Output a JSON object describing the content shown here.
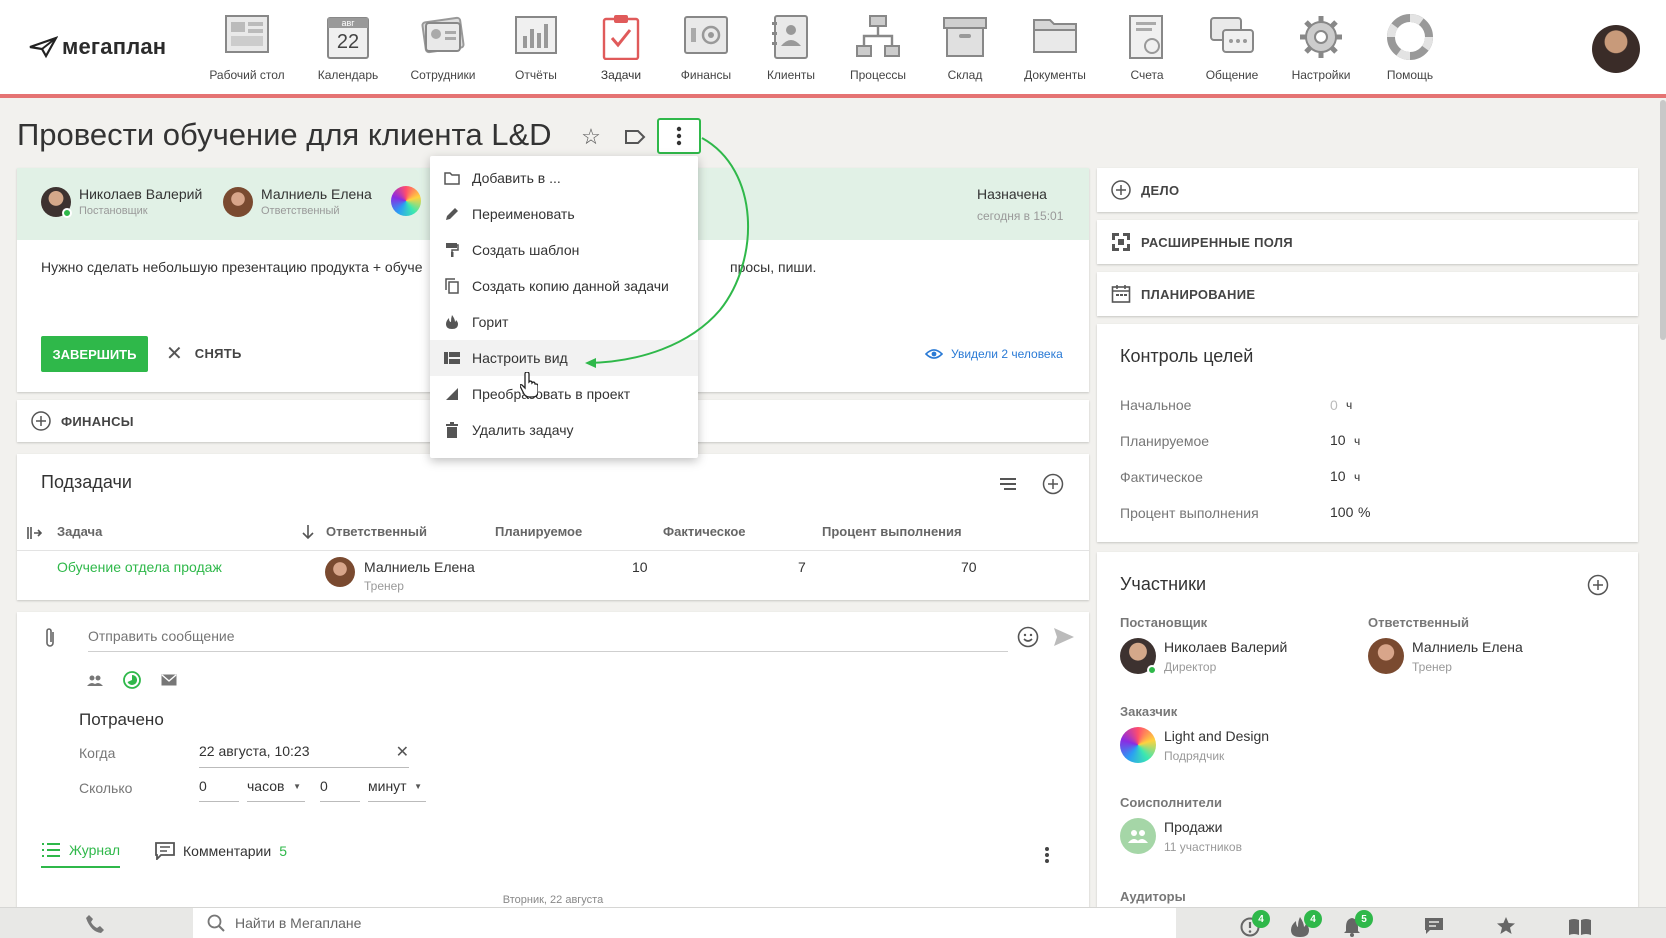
{
  "logo": {
    "text": "мегаплан"
  },
  "nav": [
    {
      "label": "Рабочий стол",
      "icon": "desktop-icon"
    },
    {
      "label": "Календарь",
      "icon": "calendar-icon",
      "month": "авг",
      "day": "22"
    },
    {
      "label": "Сотрудники",
      "icon": "employees-icon"
    },
    {
      "label": "Отчёты",
      "icon": "reports-icon"
    },
    {
      "label": "Задачи",
      "icon": "tasks-icon"
    },
    {
      "label": "Финансы",
      "icon": "finance-icon"
    },
    {
      "label": "Клиенты",
      "icon": "clients-icon"
    },
    {
      "label": "Процессы",
      "icon": "processes-icon"
    },
    {
      "label": "Склад",
      "icon": "warehouse-icon"
    },
    {
      "label": "Документы",
      "icon": "documents-icon"
    },
    {
      "label": "Счета",
      "icon": "invoices-icon"
    },
    {
      "label": "Общение",
      "icon": "chat-icon"
    },
    {
      "label": "Настройки",
      "icon": "settings-icon"
    },
    {
      "label": "Помощь",
      "icon": "help-icon"
    }
  ],
  "task": {
    "title": "Провести обучение для клиента L&D",
    "owner": {
      "name": "Николаев Валерий",
      "role": "Постановщик"
    },
    "responsible": {
      "name": "Малниель Елена",
      "role": "Ответственный"
    },
    "status": {
      "label": "Назначена",
      "time": "сегодня в 15:01"
    },
    "description_left": "Нужно сделать небольшую презентацию продукта + обуче",
    "description_right": "просы, пиши.",
    "complete_label": "ЗАВЕРШИТЬ",
    "remove_label": "СНЯТЬ",
    "seen_label": "Увидели 2 человека"
  },
  "context_menu": [
    {
      "label": "Добавить в ...",
      "icon": "folder-icon"
    },
    {
      "label": "Переименовать",
      "icon": "pencil-icon"
    },
    {
      "label": "Создать шаблон",
      "icon": "paint-roller-icon"
    },
    {
      "label": "Создать копию данной задачи",
      "icon": "copy-icon"
    },
    {
      "label": "Горит",
      "icon": "fire-icon"
    },
    {
      "label": "Настроить вид",
      "icon": "view-settings-icon"
    },
    {
      "label": "Преобразовать в проект",
      "icon": "convert-icon"
    },
    {
      "label": "Удалить задачу",
      "icon": "trash-icon"
    }
  ],
  "finance": {
    "label": "ФИНАНСЫ"
  },
  "subtasks": {
    "title": "Подзадачи",
    "columns": [
      "Задача",
      "Ответственный",
      "Планируемое",
      "Фактическое",
      "Процент выполнения"
    ],
    "rows": [
      {
        "task": "Обучение отдела продаж",
        "person": "Малниель Елена",
        "role": "Тренер",
        "planned": "10",
        "actual": "7",
        "percent": "70"
      }
    ]
  },
  "message": {
    "placeholder": "Отправить сообщение",
    "spent_title": "Потрачено",
    "when_label": "Когда",
    "when_value": "22 августа, 10:23",
    "how_much_label": "Сколько",
    "hours_value": "0",
    "hours_unit": "часов",
    "minutes_value": "0",
    "minutes_unit": "минут"
  },
  "tabs": {
    "journal": "Журнал",
    "comments": "Комментарии",
    "comments_count": "5",
    "date_divider": "Вторник, 22 августа"
  },
  "right_panel": {
    "actions": [
      "ДЕЛО",
      "РАСШИРЕННЫЕ ПОЛЯ",
      "ПЛАНИРОВАНИЕ"
    ],
    "goals": {
      "title": "Контроль целей",
      "rows": [
        {
          "label": "Начальное",
          "value": "0",
          "unit": "ч"
        },
        {
          "label": "Планируемое",
          "value": "10",
          "unit": "ч"
        },
        {
          "label": "Фактическое",
          "value": "10",
          "unit": "ч"
        },
        {
          "label": "Процент выполнения",
          "value": "100",
          "unit": "%"
        }
      ]
    },
    "participants": {
      "title": "Участники",
      "owner_label": "Постановщик",
      "owner_name": "Николаев Валерий",
      "owner_role": "Директор",
      "resp_label": "Ответственный",
      "resp_name": "Малниель Елена",
      "resp_role": "Тренер",
      "customer_label": "Заказчик",
      "customer_name": "Light and Design",
      "customer_role": "Подрядчик",
      "coexec_label": "Соисполнители",
      "coexec_name": "Продажи",
      "coexec_count": "11 участников",
      "auditors_label": "Аудиторы"
    }
  },
  "bottom": {
    "search_placeholder": "Найти в Мегаплане",
    "badges": [
      "4",
      "4",
      "5"
    ]
  },
  "colors": {
    "accent": "#2fb84a",
    "topbar_line": "#e57373",
    "task_header_bg": "#e1f1e6",
    "link": "#2fb84a",
    "seen": "#2a7ad5"
  }
}
